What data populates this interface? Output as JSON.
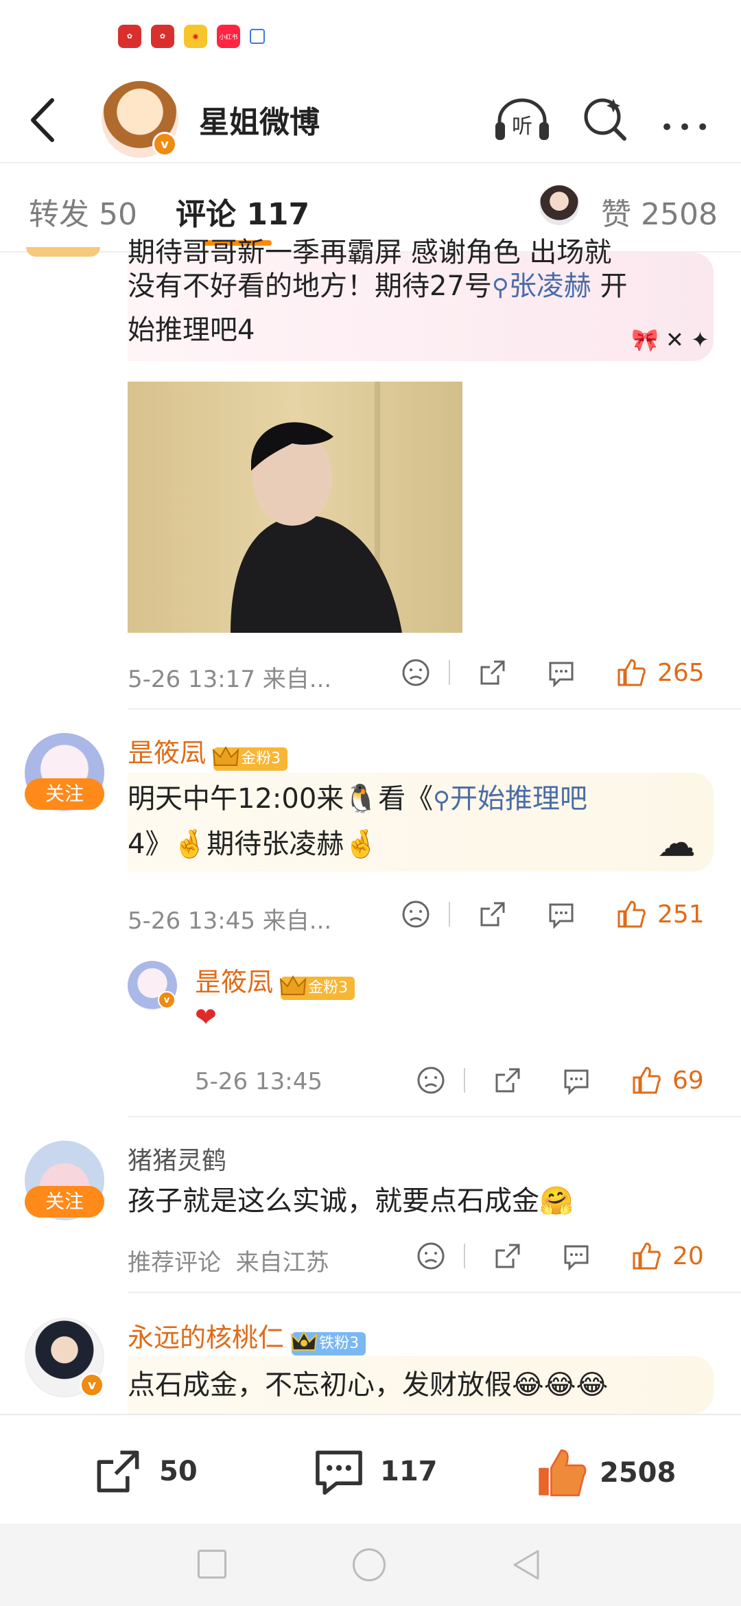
{
  "status_bar": {
    "app_icons": [
      "huawei-app-icon",
      "huawei-app-icon",
      "weibo-icon",
      "xiaohongshu-icon",
      "calendar-icon"
    ],
    "xiaohongshu_label": "小红书"
  },
  "header": {
    "title": "星姐微博",
    "listen_label": "听"
  },
  "tabs": {
    "repost": "转发 50",
    "comments": "评论 117",
    "likes": "赞 2508"
  },
  "comment1": {
    "line1": "期待哥哥新一季再霸屏 感谢角色 出场就",
    "line2a": "没有不好看的地方！期待27号",
    "topic": "张凌赫",
    "line2b": " 开",
    "line3": "始推理吧4",
    "time": "5-26 13:17",
    "source": "来自...",
    "likes": "265"
  },
  "comment2": {
    "user": "昰筱凨",
    "badge": "金粉3",
    "follow": "关注",
    "text1a": "明天中午12:00来",
    "text1b": "看《",
    "topic": "开始推理吧",
    "text2a": "4》",
    "text2b": "期待张凌赫",
    "time": "5-26 13:45",
    "source": "来自...",
    "likes": "251"
  },
  "reply1": {
    "user": "昰筱凨",
    "badge": "金粉3",
    "text": "❤",
    "time": "5-26 13:45",
    "likes": "69"
  },
  "comment3": {
    "user": "猪猪灵鹤",
    "follow": "关注",
    "text": "孩子就是这么实诚，就要点石成金",
    "tag": "推荐评论",
    "source": "来自江苏",
    "likes": "20"
  },
  "comment4": {
    "user": "永远的核桃仁",
    "badge": "铁粉3",
    "text": "点石成金，不忘初心，发财放假"
  },
  "bottom_bar": {
    "reposts": "50",
    "comments": "117",
    "likes": "2508"
  },
  "colors": {
    "accent": "#ff8a00",
    "username": "#e06b17",
    "topic": "#4a6ca8"
  }
}
